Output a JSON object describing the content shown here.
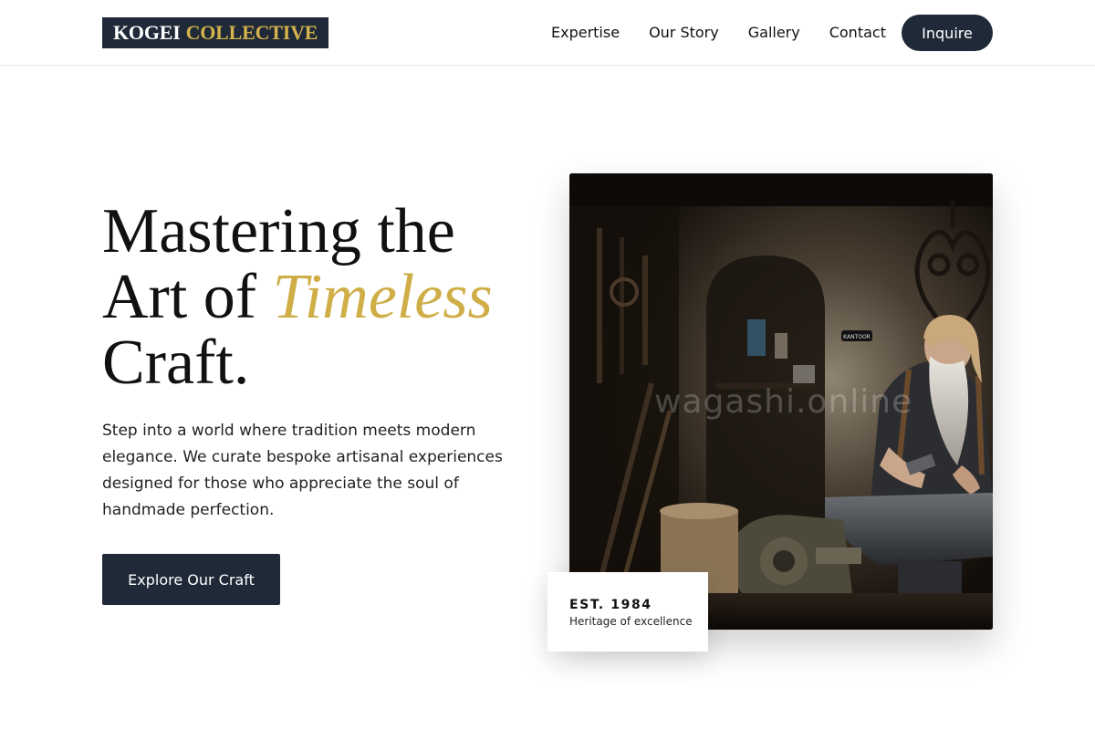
{
  "brand": {
    "word1": "KOGEI",
    "word2": "COLLECTIVE",
    "colors": {
      "navy": "#1f2937",
      "gold": "#d4b24c"
    }
  },
  "nav": {
    "links": [
      "Expertise",
      "Our Story",
      "Gallery",
      "Contact"
    ],
    "inquire_label": "Inquire"
  },
  "hero": {
    "headline_line1": "Mastering the",
    "headline_pre": "Art of ",
    "headline_accent": "Timeless",
    "headline_line3": "Craft.",
    "description": "Step into a world where tradition meets modern elegance. We curate bespoke artisanal experiences designed for those who appreciate the soul of handmade perfection.",
    "cta_label": "Explore Our Craft"
  },
  "photo": {
    "watermark": "wagashi.online",
    "sign_text": "KANTOOR"
  },
  "badge": {
    "title": "EST. 1984",
    "subtitle": "Heritage of excellence"
  }
}
